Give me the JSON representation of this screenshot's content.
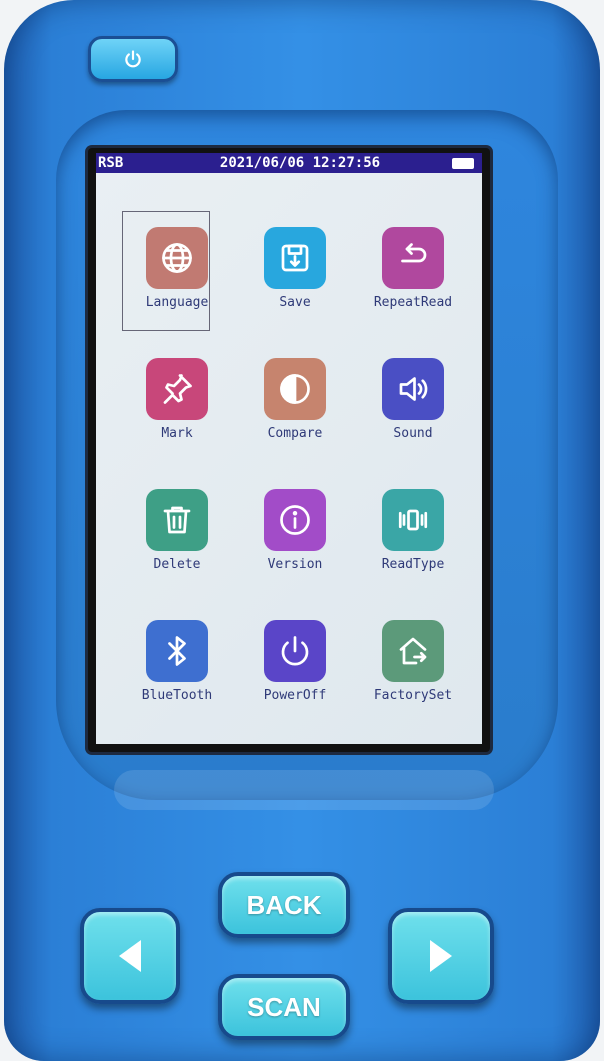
{
  "status": {
    "left": "RSB",
    "datetime": "2021/06/06 12:27:56"
  },
  "menu": {
    "items": [
      {
        "label": "Language",
        "icon": "globe-icon",
        "color": "#c17a72",
        "selected": true
      },
      {
        "label": "Save",
        "icon": "save-icon",
        "color": "#28a7de",
        "selected": false
      },
      {
        "label": "RepeatRead",
        "icon": "undo-arrow-icon",
        "color": "#b0489e",
        "selected": false
      },
      {
        "label": "Mark",
        "icon": "pin-icon",
        "color": "#c8477a",
        "selected": false
      },
      {
        "label": "Compare",
        "icon": "contrast-icon",
        "color": "#c6846e",
        "selected": false
      },
      {
        "label": "Sound",
        "icon": "speaker-icon",
        "color": "#4a4fc4",
        "selected": false
      },
      {
        "label": "Delete",
        "icon": "trash-icon",
        "color": "#3e9f86",
        "selected": false
      },
      {
        "label": "Version",
        "icon": "info-icon",
        "color": "#a24cc8",
        "selected": false
      },
      {
        "label": "ReadType",
        "icon": "vibrate-icon",
        "color": "#3aa6a6",
        "selected": false
      },
      {
        "label": "BlueTooth",
        "icon": "bluetooth-icon",
        "color": "#3e6fd0",
        "selected": false
      },
      {
        "label": "PowerOff",
        "icon": "power-icon",
        "color": "#5a45c8",
        "selected": false
      },
      {
        "label": "FactorySet",
        "icon": "home-exit-icon",
        "color": "#5c9a7a",
        "selected": false
      }
    ]
  },
  "buttons": {
    "back": "BACK",
    "scan": "SCAN",
    "left_icon": "arrow-left-icon",
    "right_icon": "arrow-right-icon",
    "power_icon": "power-icon"
  }
}
